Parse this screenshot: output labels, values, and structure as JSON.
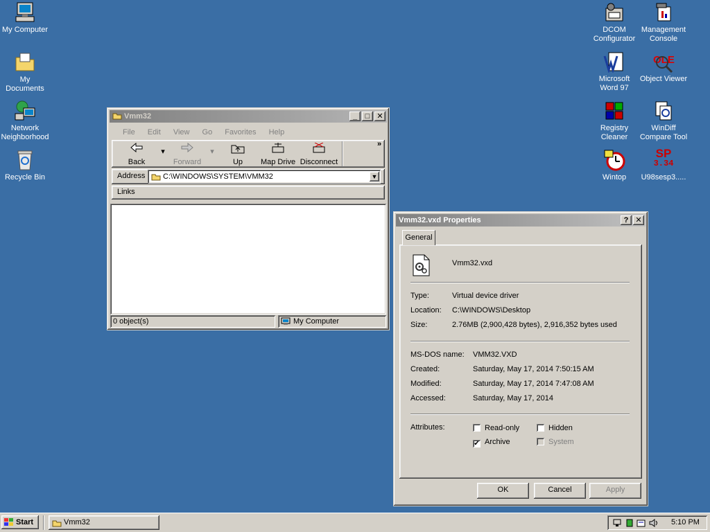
{
  "desktop": {
    "icons_left": [
      {
        "label": "My Computer",
        "icon": "computer-icon"
      },
      {
        "label": "My Documents",
        "icon": "folder-documents-icon"
      },
      {
        "label": "Network Neighborhood",
        "icon": "network-icon"
      },
      {
        "label": "Recycle Bin",
        "icon": "recycle-bin-icon"
      }
    ],
    "icons_right": [
      {
        "label": "DCOM Configurator",
        "icon": "dcom-icon"
      },
      {
        "label": "Management Console",
        "icon": "management-console-icon"
      },
      {
        "label": "Microsoft Word 97",
        "icon": "word-icon"
      },
      {
        "label": "Object Viewer",
        "icon": "ole-viewer-icon"
      },
      {
        "label": "Registry Cleaner",
        "icon": "registry-icon"
      },
      {
        "label": "WinDiff Compare Tool",
        "icon": "windiff-icon"
      },
      {
        "label": "Wintop",
        "icon": "wintop-icon"
      },
      {
        "label": "U98sesp3.....",
        "icon": "service-pack-icon",
        "badge_top": "SP",
        "badge_bottom": "3.34"
      }
    ]
  },
  "explorer": {
    "title": "Vmm32",
    "menu": [
      "File",
      "Edit",
      "View",
      "Go",
      "Favorites",
      "Help"
    ],
    "toolbar": {
      "back": "Back",
      "forward": "Forward",
      "up": "Up",
      "map_drive": "Map Drive",
      "disconnect": "Disconnect",
      "more": "»"
    },
    "address_label": "Address",
    "address_value": "C:\\WINDOWS\\SYSTEM\\VMM32",
    "links_label": "Links",
    "status_objects": "0 object(s)",
    "status_location": "My Computer"
  },
  "properties": {
    "title": "Vmm32.vxd Properties",
    "help_btn": "?",
    "tab": "General",
    "filename": "Vmm32.vxd",
    "type_label": "Type:",
    "type_value": "Virtual device driver",
    "location_label": "Location:",
    "location_value": "C:\\WINDOWS\\Desktop",
    "size_label": "Size:",
    "size_value": "2.76MB (2,900,428 bytes), 2,916,352 bytes used",
    "msdos_label": "MS-DOS name:",
    "msdos_value": "VMM32.VXD",
    "created_label": "Created:",
    "created_value": "Saturday, May 17, 2014 7:50:15 AM",
    "modified_label": "Modified:",
    "modified_value": "Saturday, May 17, 2014 7:47:08 AM",
    "accessed_label": "Accessed:",
    "accessed_value": "Saturday, May 17, 2014",
    "attributes_label": "Attributes:",
    "readonly": "Read-only",
    "hidden": "Hidden",
    "archive": "Archive",
    "system": "System",
    "ok": "OK",
    "cancel": "Cancel",
    "apply": "Apply"
  },
  "taskbar": {
    "start": "Start",
    "task": "Vmm32",
    "clock": "5:10 PM"
  }
}
